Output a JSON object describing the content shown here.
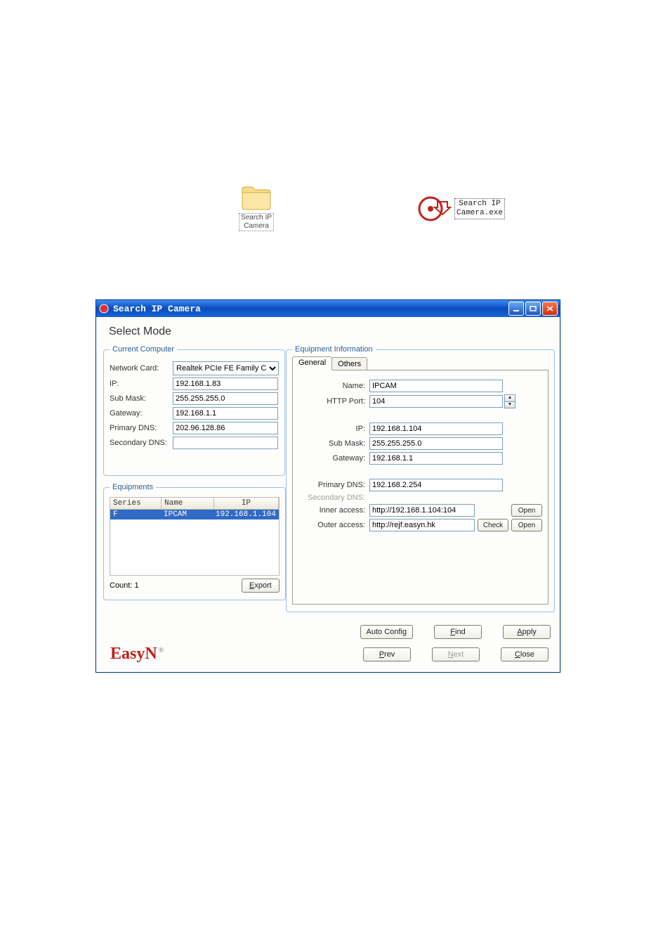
{
  "desktop_icons": {
    "folder_label": "Search IP\nCamera",
    "cd_label": "Search IP\nCamera.exe"
  },
  "window": {
    "title": "Search IP Camera",
    "heading": "Select Mode"
  },
  "current_computer": {
    "legend": "Current Computer",
    "network_card_label": "Network Card:",
    "network_card_value": "Realtek PCIe FE Family C",
    "ip_label": "IP:",
    "ip_value": "192.168.1.83",
    "submask_label": "Sub Mask:",
    "submask_value": "255.255.255.0",
    "gateway_label": "Gateway:",
    "gateway_value": "192.168.1.1",
    "pdns_label": "Primary DNS:",
    "pdns_value": "202.96.128.86",
    "sdns_label": "Secondary DNS:",
    "sdns_value": ""
  },
  "equipments": {
    "legend": "Equipments",
    "headers": {
      "series": "Series",
      "name": "Name",
      "ip": "IP"
    },
    "row": {
      "series": "F",
      "name": "IPCAM",
      "ip": "192.168.1.104"
    },
    "count_label": "Count: 1",
    "export_label": "Export"
  },
  "equipment_info": {
    "legend": "Equipment Information",
    "tabs": {
      "general": "General",
      "others": "Others"
    },
    "name_label": "Name:",
    "name_value": "IPCAM",
    "port_label": "HTTP Port:",
    "port_value": "104",
    "ip_label": "IP:",
    "ip_value": "192.168.1.104",
    "submask_label": "Sub Mask:",
    "submask_value": "255.255.255.0",
    "gateway_label": "Gateway:",
    "gateway_value": "192.168.1.1",
    "pdns_label": "Primary DNS:",
    "pdns_value": "192.168.2.254",
    "sdns_label": "Secondary DNS:",
    "sdns_value": "",
    "inner_label": "Inner access:",
    "inner_value": "http://192.168.1.104:104",
    "outer_label": "Outer access:",
    "outer_value": "http://rejf.easyn.hk",
    "open_label": "Open",
    "check_label": "Check"
  },
  "buttons": {
    "auto_config": "Auto Config",
    "find": "Find",
    "apply": "Apply",
    "prev": "Prev",
    "next": "Next",
    "close": "Close"
  },
  "brand": "EasyN"
}
